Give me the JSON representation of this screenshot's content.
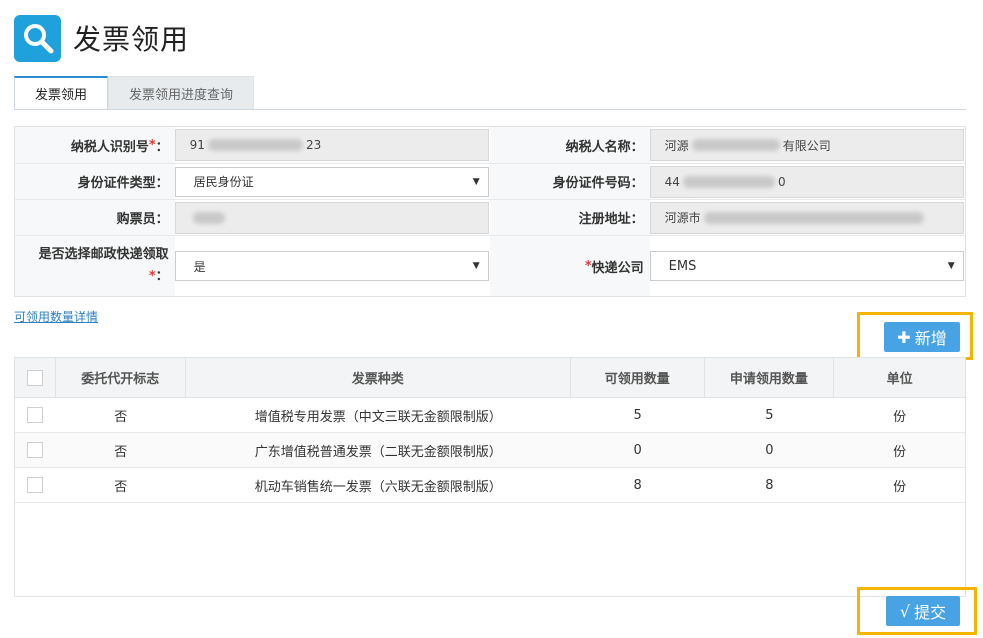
{
  "header": {
    "title": "发票领用"
  },
  "tabs": [
    "发票领用",
    "发票领用进度查询"
  ],
  "form": {
    "taxpayer_id_label": "纳税人识别号",
    "taxpayer_id_prefix": "91",
    "taxpayer_id_suffix": "23",
    "taxpayer_name_label": "纳税人名称：",
    "taxpayer_name_prefix": "河源",
    "taxpayer_name_suffix": "有限公司",
    "id_type_label": "身份证件类型：",
    "id_type_value": "居民身份证",
    "id_number_label": "身份证件号码：",
    "id_number_prefix": "44",
    "id_number_suffix": "0",
    "buyer_label": "购票员：",
    "address_label": "注册地址：",
    "address_prefix": "河源市",
    "express_label_line1": "是否选择邮政快递领取",
    "express_label_line2": "：",
    "express_value": "是",
    "courier_label": "快递公司",
    "courier_value": "EMS"
  },
  "detail_link": "可领用数量详情",
  "add_button": "新增",
  "submit_button": "提交",
  "table": {
    "headers": [
      "委托代开标志",
      "发票种类",
      "可领用数量",
      "申请领用数量",
      "单位"
    ],
    "rows": [
      [
        "否",
        "增值税专用发票（中文三联无金额限制版）",
        "5",
        "5",
        "份"
      ],
      [
        "否",
        "广东增值税普通发票（二联无金额限制版）",
        "0",
        "0",
        "份"
      ],
      [
        "否",
        "机动车销售统一发票（六联无金额限制版）",
        "8",
        "8",
        "份"
      ]
    ]
  },
  "colors": {
    "accent": "#48a3e5",
    "highlight": "#f5b400",
    "logo": "#1fa2dc"
  }
}
